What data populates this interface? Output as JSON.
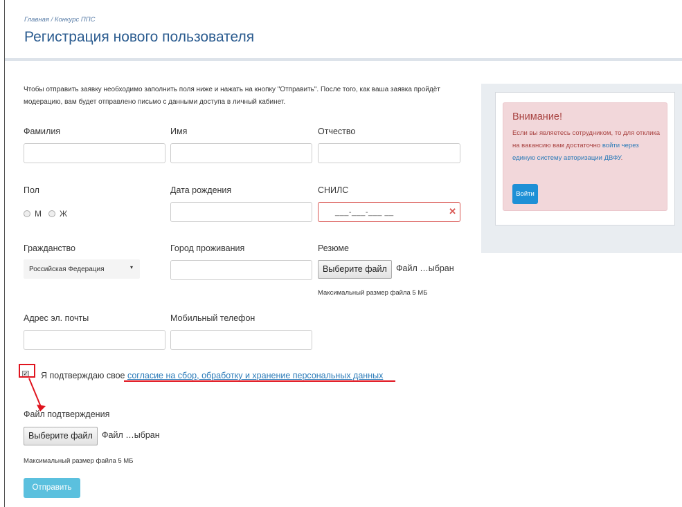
{
  "breadcrumb": "Главная / Конкурс ППС",
  "page_title": "Регистрация нового пользователя",
  "intro_text": "Чтобы отправить заявку необходимо заполнить поля ниже и нажать на кнопку \"Отправить\". После того, как ваша заявка пройдёт модерацию, вам будет отправлено письмо с данными доступа в личный кабинет.",
  "form": {
    "last_name_label": "Фамилия",
    "first_name_label": "Имя",
    "patronymic_label": "Отчество",
    "gender_label": "Пол",
    "gender_m": "М",
    "gender_f": "Ж",
    "birth_date_label": "Дата рождения",
    "snils_label": "СНИЛС",
    "snils_mask": "___-___-___ __",
    "citizenship_label": "Гражданство",
    "citizenship_value": "Российская Федерация",
    "city_label": "Город проживания",
    "resume_label": "Резюме",
    "file_button": "Выберите файл",
    "file_status": "Файл …ыбран",
    "max_size_hint": "Максимальный размер файла 5 МБ",
    "email_label": "Адрес эл. почты",
    "phone_label": "Мобильный телефон",
    "consent_text": "Я подтверждаю свое ",
    "consent_link": "согласие на сбор, обработку и хранение персональных данных",
    "confirmation_file_label": "Файл подтверждения",
    "submit_label": "Отправить"
  },
  "sidebar": {
    "alert_title": "Внимание!",
    "alert_text": "Если вы являетесь сотрудником, то для отклика на вакансию вам достаточно ",
    "alert_link": "войти через единую систему авторизации ДВФУ",
    "alert_text_end": ".",
    "login_button": "Войти"
  },
  "colors": {
    "title": "#2a5b8f",
    "link": "#2a7ab8",
    "annotation_red": "#e0141e",
    "alert_bg": "#f2d7da",
    "submit_bg": "#5bc0de",
    "login_bg": "#1e90d6"
  }
}
